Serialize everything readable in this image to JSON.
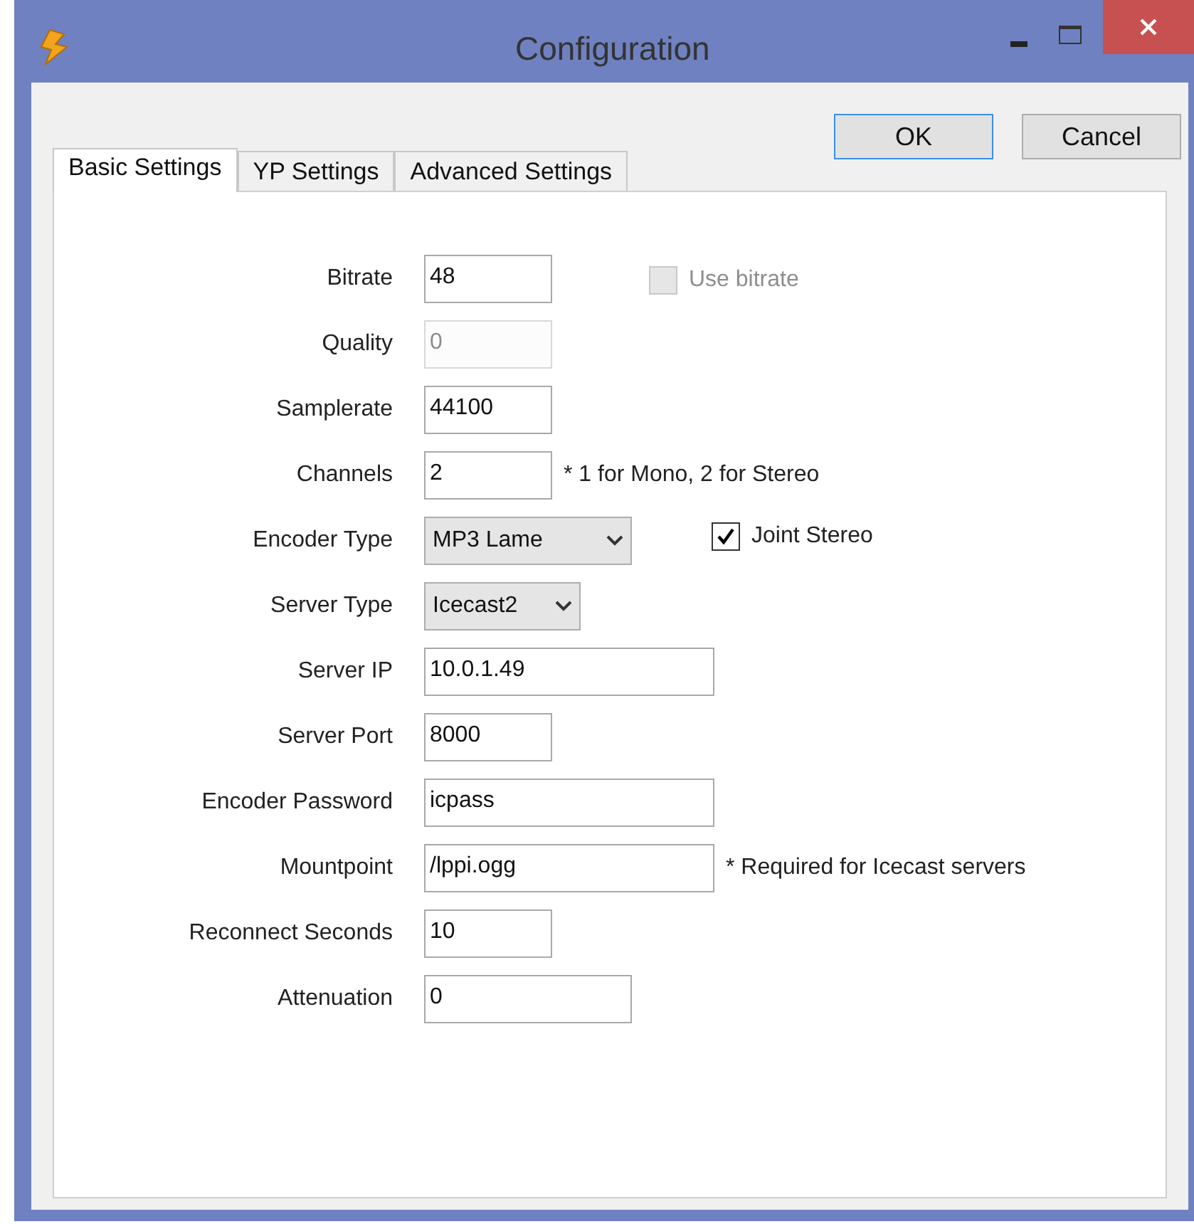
{
  "window": {
    "title": "Configuration"
  },
  "buttons": [
    {
      "label": "OK",
      "default": true
    },
    {
      "label": "Cancel",
      "default": false
    }
  ],
  "tabs": [
    {
      "label": "Basic Settings",
      "selected": true
    },
    {
      "label": "YP Settings",
      "selected": false
    },
    {
      "label": "Advanced Settings",
      "selected": false
    }
  ],
  "fields": [
    {
      "label": "Bitrate",
      "kind": "text",
      "value": "48",
      "disabled": false,
      "extra": {
        "kind": "checkbox",
        "label": "Use bitrate",
        "checked": false,
        "disabled": true
      }
    },
    {
      "label": "Quality",
      "kind": "text",
      "value": "0",
      "disabled": true
    },
    {
      "label": "Samplerate",
      "kind": "text",
      "value": "44100",
      "disabled": false
    },
    {
      "label": "Channels",
      "kind": "text",
      "value": "2",
      "disabled": false,
      "extra": {
        "kind": "note",
        "text": "* 1 for Mono, 2 for Stereo"
      }
    },
    {
      "label": "Encoder Type",
      "kind": "select",
      "value": "MP3 Lame",
      "disabled": false,
      "extra": {
        "kind": "checkbox",
        "label": "Joint Stereo",
        "checked": true,
        "disabled": false
      }
    },
    {
      "label": "Server Type",
      "kind": "select",
      "value": "Icecast2",
      "disabled": false
    },
    {
      "label": "Server IP",
      "kind": "text",
      "value": "10.0.1.49",
      "disabled": false
    },
    {
      "label": "Server Port",
      "kind": "text",
      "value": "8000",
      "disabled": false
    },
    {
      "label": "Encoder Password",
      "kind": "text",
      "value": "icpass",
      "disabled": false
    },
    {
      "label": "Mountpoint",
      "kind": "text",
      "value": "/lppi.ogg",
      "disabled": false,
      "extra": {
        "kind": "note",
        "text": "* Required for Icecast servers"
      }
    },
    {
      "label": "Reconnect Seconds",
      "kind": "text",
      "value": "10",
      "disabled": false
    },
    {
      "label": "Attenuation",
      "kind": "text",
      "value": "0",
      "disabled": false
    }
  ]
}
